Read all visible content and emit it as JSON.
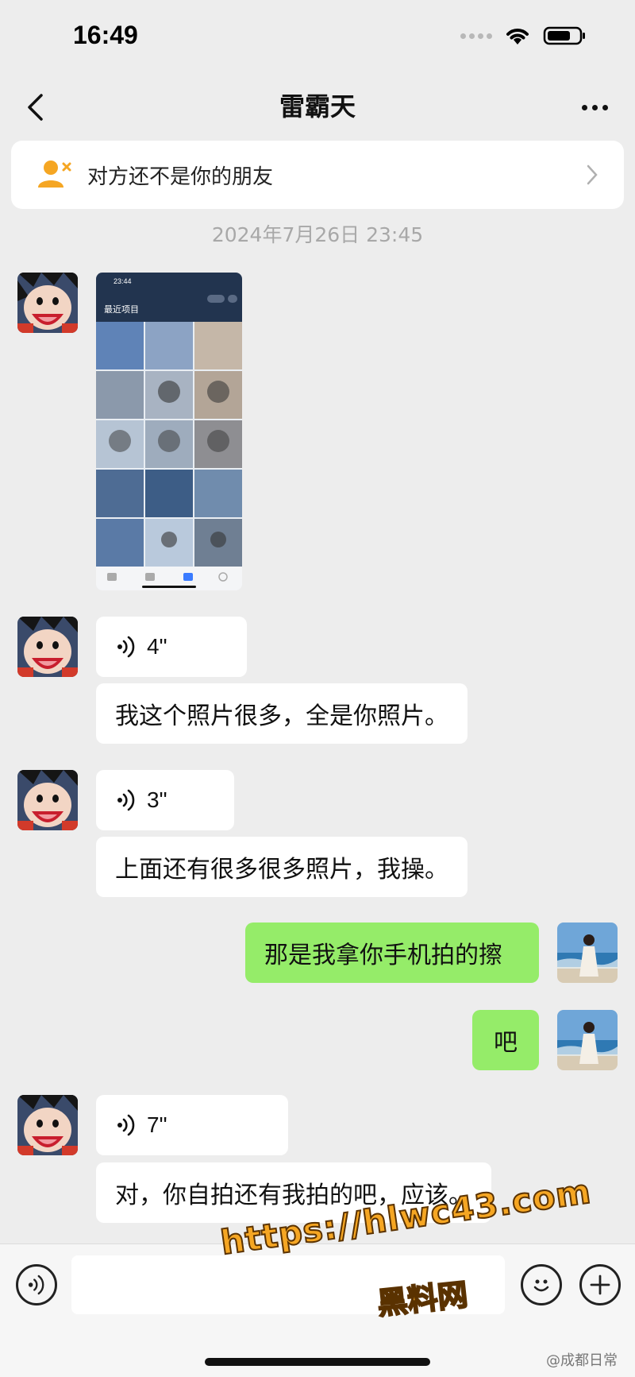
{
  "status_bar": {
    "time": "16:49"
  },
  "nav": {
    "title": "雷霸天"
  },
  "friend_banner": {
    "text": "对方还不是你的朋友"
  },
  "timestamp": "2024年7月26日 23:45",
  "screenshot_thumb": {
    "time": "23:44",
    "album_label": "最近项目"
  },
  "messages": [
    {
      "type": "voice",
      "duration": "4\""
    },
    {
      "type": "text",
      "text": "我这个照片很多，全是你照片。"
    },
    {
      "type": "voice",
      "duration": "3\""
    },
    {
      "type": "text",
      "text": "上面还有很多很多照片，我操。"
    },
    {
      "type": "text",
      "text": "那是我拿你手机拍的擦"
    },
    {
      "type": "text",
      "text": "吧"
    },
    {
      "type": "voice",
      "duration": "7\""
    },
    {
      "type": "text",
      "text": "对，你自拍还有我拍的吧，应该。"
    }
  ],
  "input": {
    "value": ""
  },
  "watermark": {
    "url": "https://hlwc43.com",
    "name": "黑料网",
    "source": "@成都日常"
  },
  "colors": {
    "sent_bubble": "#95ec69",
    "received_bubble": "#ffffff",
    "background": "#ededed",
    "banner_icon": "#f5a623"
  }
}
